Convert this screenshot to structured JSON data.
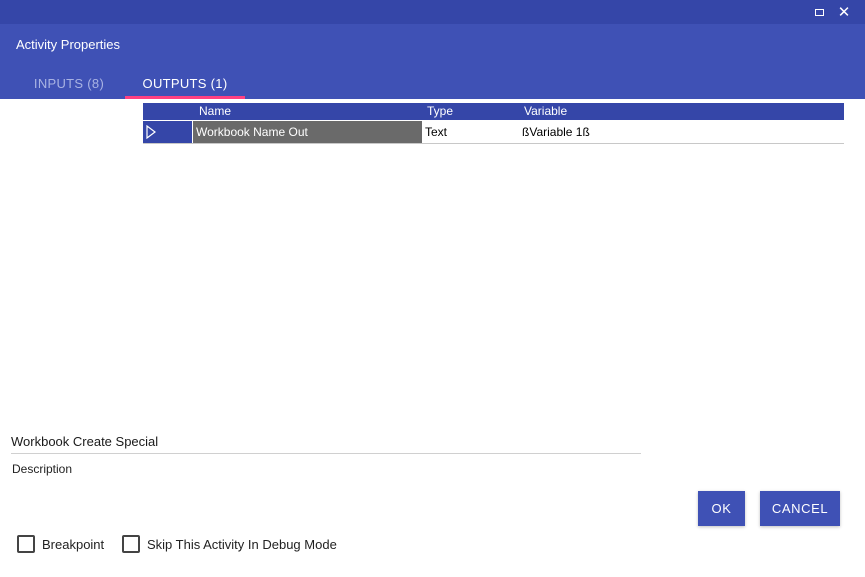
{
  "window": {
    "maximize_icon": "maximize-icon",
    "close_icon": "close-icon",
    "close_glyph": "✕"
  },
  "dialog": {
    "title": "Activity Properties"
  },
  "tabs": [
    {
      "label": "INPUTS (8)",
      "active": false
    },
    {
      "label": "OUTPUTS (1)",
      "active": true
    }
  ],
  "grid": {
    "columns": [
      "Name",
      "Type",
      "Variable"
    ],
    "rows": [
      {
        "name": "Workbook Name Out",
        "type": "Text",
        "variable": "ßVariable 1ß"
      }
    ]
  },
  "activity": {
    "name": "Workbook Create Special",
    "description_label": "Description"
  },
  "buttons": {
    "ok": "OK",
    "cancel": "CANCEL"
  },
  "options": {
    "breakpoint": {
      "label": "Breakpoint",
      "checked": false
    },
    "skip_debug": {
      "label": "Skip This Activity In Debug Mode",
      "checked": false
    }
  },
  "colors": {
    "titlebar": "#3546a8",
    "header": "#3f51b5",
    "tab_indicator": "#ff4081",
    "selected_cell": "#6a6a6a"
  }
}
